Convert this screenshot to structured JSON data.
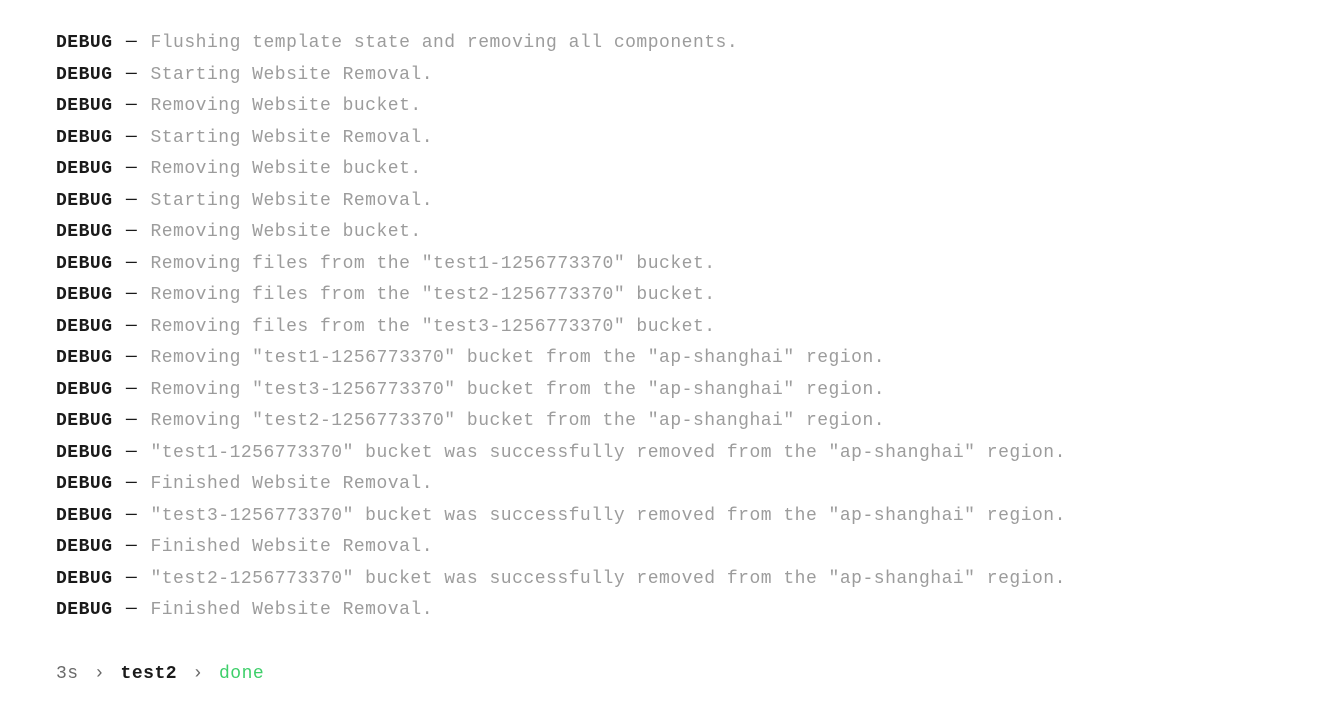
{
  "log": {
    "lines": [
      {
        "level": "DEBUG",
        "sep": "─",
        "msg": "Flushing template state and removing all components."
      },
      {
        "level": "DEBUG",
        "sep": "─",
        "msg": "Starting Website Removal."
      },
      {
        "level": "DEBUG",
        "sep": "─",
        "msg": "Removing Website bucket."
      },
      {
        "level": "DEBUG",
        "sep": "─",
        "msg": "Starting Website Removal."
      },
      {
        "level": "DEBUG",
        "sep": "─",
        "msg": "Removing Website bucket."
      },
      {
        "level": "DEBUG",
        "sep": "─",
        "msg": "Starting Website Removal."
      },
      {
        "level": "DEBUG",
        "sep": "─",
        "msg": "Removing Website bucket."
      },
      {
        "level": "DEBUG",
        "sep": "─",
        "msg": "Removing files from the \"test1-1256773370\" bucket."
      },
      {
        "level": "DEBUG",
        "sep": "─",
        "msg": "Removing files from the \"test2-1256773370\" bucket."
      },
      {
        "level": "DEBUG",
        "sep": "─",
        "msg": "Removing files from the \"test3-1256773370\" bucket."
      },
      {
        "level": "DEBUG",
        "sep": "─",
        "msg": "Removing \"test1-1256773370\" bucket from the \"ap-shanghai\" region."
      },
      {
        "level": "DEBUG",
        "sep": "─",
        "msg": "Removing \"test3-1256773370\" bucket from the \"ap-shanghai\" region."
      },
      {
        "level": "DEBUG",
        "sep": "─",
        "msg": "Removing \"test2-1256773370\" bucket from the \"ap-shanghai\" region."
      },
      {
        "level": "DEBUG",
        "sep": "─",
        "msg": "\"test1-1256773370\" bucket was successfully removed from the \"ap-shanghai\" region."
      },
      {
        "level": "DEBUG",
        "sep": "─",
        "msg": "Finished Website Removal."
      },
      {
        "level": "DEBUG",
        "sep": "─",
        "msg": "\"test3-1256773370\" bucket was successfully removed from the \"ap-shanghai\" region."
      },
      {
        "level": "DEBUG",
        "sep": "─",
        "msg": "Finished Website Removal."
      },
      {
        "level": "DEBUG",
        "sep": "─",
        "msg": "\"test2-1256773370\" bucket was successfully removed from the \"ap-shanghai\" region."
      },
      {
        "level": "DEBUG",
        "sep": "─",
        "msg": "Finished Website Removal."
      }
    ]
  },
  "status": {
    "time": "3s",
    "arrow": "›",
    "name": "test2",
    "state": "done"
  }
}
